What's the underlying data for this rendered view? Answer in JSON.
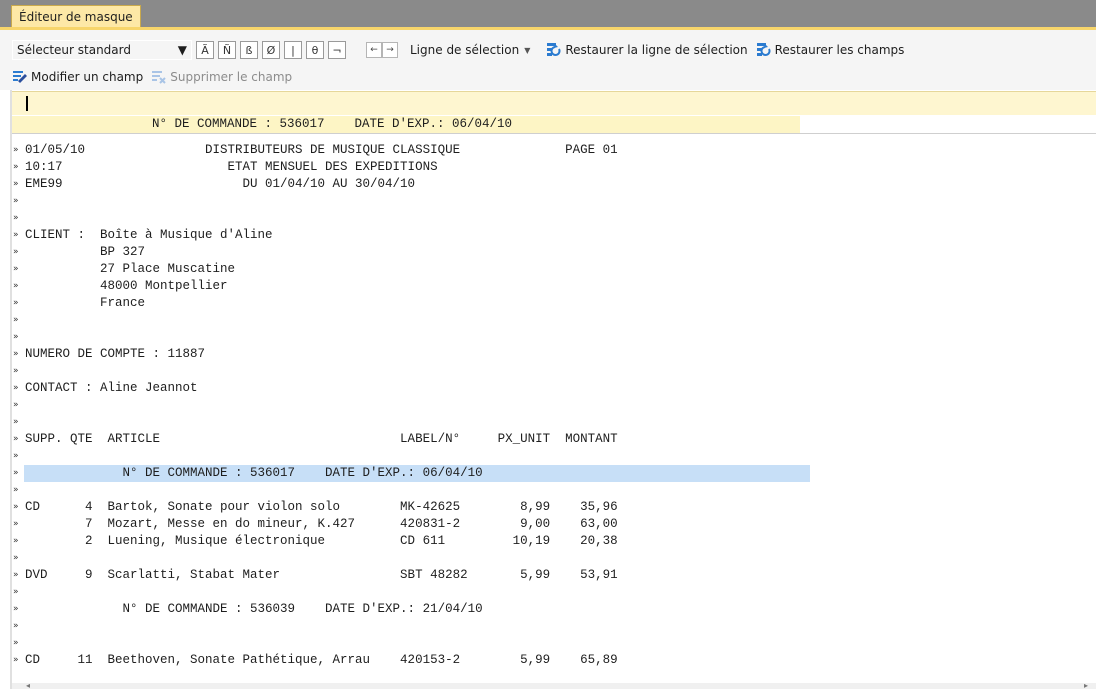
{
  "tab": {
    "label": "Éditeur de masque"
  },
  "toolbar": {
    "selector": "Sélecteur standard",
    "char_buttons": [
      "Ã",
      "Ñ",
      "ß",
      "Ø",
      "|",
      "θ",
      "¬"
    ],
    "nav_left": "←",
    "nav_right": "→",
    "selection_line": "Ligne de sélection",
    "restore_selection": "Restaurer la ligne de sélection",
    "restore_fields": "Restaurer les champs",
    "modify_field": "Modifier un champ",
    "delete_field": "Supprimer le champ"
  },
  "mask_line": "N° DE COMMANDE : 536017    DATE D'EXP.: 06/04/10",
  "report": {
    "lines": [
      {
        "marker": "»",
        "text": "01/05/10                DISTRIBUTEURS DE MUSIQUE CLASSIQUE              PAGE 01"
      },
      {
        "marker": "»",
        "text": "10:17                      ETAT MENSUEL DES EXPEDITIONS"
      },
      {
        "marker": "»",
        "text": "EME99                        DU 01/04/10 AU 30/04/10"
      },
      {
        "marker": "»",
        "text": ""
      },
      {
        "marker": "»",
        "text": ""
      },
      {
        "marker": "»",
        "text": "CLIENT :  Boîte à Musique d'Aline"
      },
      {
        "marker": "»",
        "text": "          BP 327"
      },
      {
        "marker": "»",
        "text": "          27 Place Muscatine"
      },
      {
        "marker": "»",
        "text": "          48000 Montpellier"
      },
      {
        "marker": "»",
        "text": "          France"
      },
      {
        "marker": "»",
        "text": ""
      },
      {
        "marker": "»",
        "text": ""
      },
      {
        "marker": "»",
        "text": "NUMERO DE COMPTE : 11887"
      },
      {
        "marker": "»",
        "text": ""
      },
      {
        "marker": "»",
        "text": "CONTACT : Aline Jeannot"
      },
      {
        "marker": "»",
        "text": ""
      },
      {
        "marker": "»",
        "text": ""
      },
      {
        "marker": "»",
        "text": "SUPP. QTE  ARTICLE                                LABEL/N°     PX_UNIT  MONTANT"
      },
      {
        "marker": "»",
        "text": ""
      },
      {
        "marker": "»",
        "text": "             N° DE COMMANDE : 536017    DATE D'EXP.: 06/04/10",
        "highlight": true
      },
      {
        "marker": "»",
        "text": ""
      },
      {
        "marker": "»",
        "text": "CD      4  Bartok, Sonate pour violon solo        MK-42625        8,99    35,96"
      },
      {
        "marker": "»",
        "text": "        7  Mozart, Messe en do mineur, K.427      420831-2        9,00    63,00"
      },
      {
        "marker": "»",
        "text": "        2  Luening, Musique électronique          CD 611         10,19    20,38"
      },
      {
        "marker": "»",
        "text": ""
      },
      {
        "marker": "»",
        "text": "DVD     9  Scarlatti, Stabat Mater                SBT 48282       5,99    53,91"
      },
      {
        "marker": "»",
        "text": ""
      },
      {
        "marker": "»",
        "text": "             N° DE COMMANDE : 536039    DATE D'EXP.: 21/04/10"
      },
      {
        "marker": "»",
        "text": ""
      },
      {
        "marker": "»",
        "text": ""
      },
      {
        "marker": "»",
        "text": "CD     11  Beethoven, Sonate Pathétique, Arrau    420153-2        5,99    65,89"
      }
    ]
  },
  "scrollbar": {
    "left_arrow": "◂",
    "right_arrow": "▸"
  },
  "colors": {
    "tab_bg": "#fde8a6",
    "accent": "#f7d56b",
    "edit_line_bg": "#fef6d0",
    "selection_highlight": "#c7dff7"
  }
}
